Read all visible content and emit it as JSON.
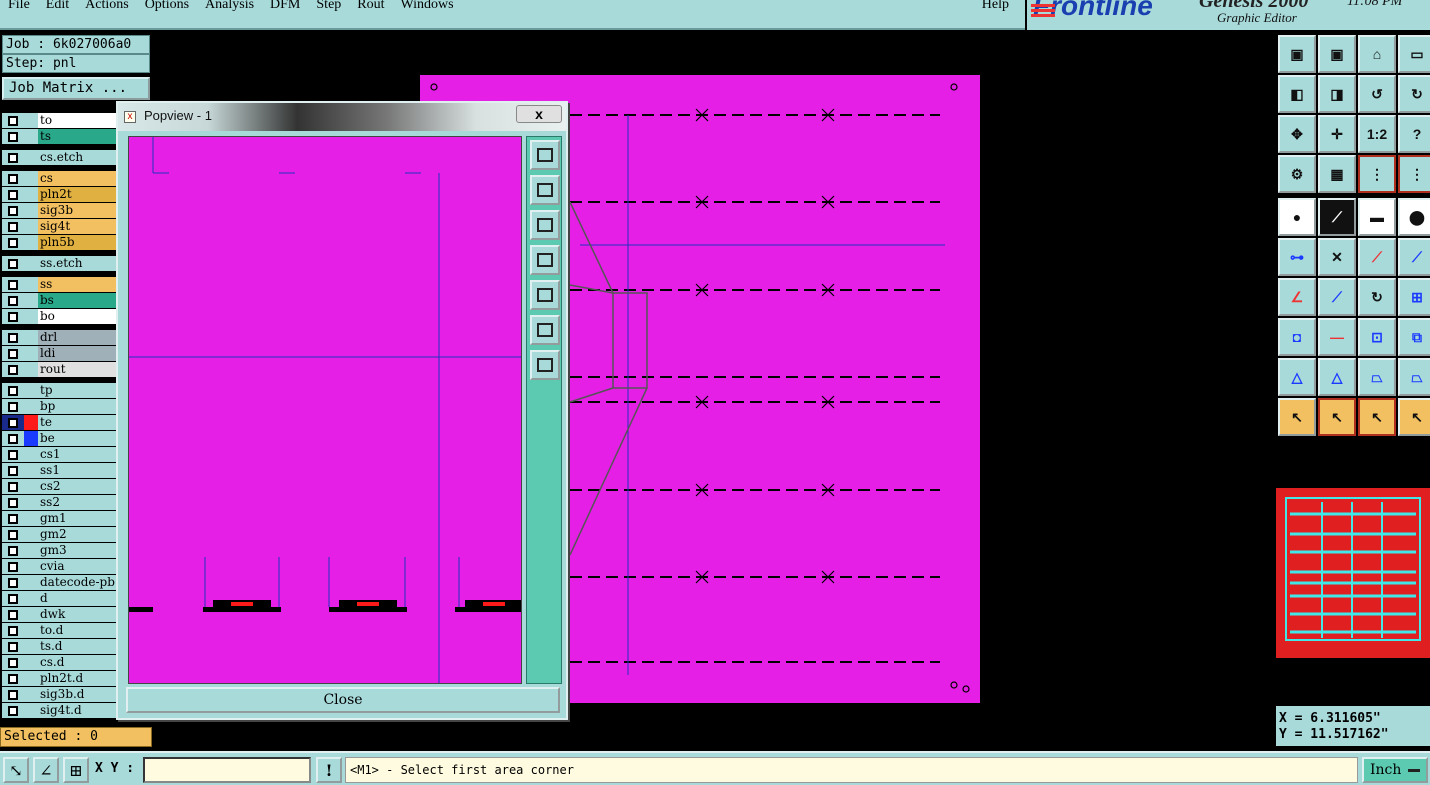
{
  "menu": {
    "items": [
      "File",
      "Edit",
      "Actions",
      "Options",
      "Analysis",
      "DFM",
      "Step",
      "Rout",
      "Windows"
    ],
    "help": "Help"
  },
  "brand": {
    "logo": "Frontline",
    "product": "Genesis 2000",
    "subtitle": "Graphic Editor",
    "clock": "11:08 PM"
  },
  "job": {
    "job_label": "Job : 6k027006a0",
    "step_label": "Step: pnl",
    "matrix_button": "Job Matrix ..."
  },
  "layers": [
    {
      "name": "to",
      "color": "#ffffff"
    },
    {
      "name": "ts",
      "color": "#2aa88a"
    },
    {
      "name": "cs.etch",
      "color": "#a8dada"
    },
    {
      "name": "cs",
      "color": "#f2c060"
    },
    {
      "name": "pln2t",
      "color": "#e0b040"
    },
    {
      "name": "sig3b",
      "color": "#f2c060"
    },
    {
      "name": "sig4t",
      "color": "#f2c060"
    },
    {
      "name": "pln5b",
      "color": "#e0b040"
    },
    {
      "name": "ss.etch",
      "color": "#a8dada"
    },
    {
      "name": "ss",
      "color": "#f2c060"
    },
    {
      "name": "bs",
      "color": "#2aa88a"
    },
    {
      "name": "bo",
      "color": "#ffffff"
    },
    {
      "name": "drl",
      "color": "#a0b0b8"
    },
    {
      "name": "ldi",
      "color": "#a0b0b8"
    },
    {
      "name": "rout",
      "color": "#e0e0e0"
    },
    {
      "name": "tp",
      "color": "#a8dada"
    },
    {
      "name": "bp",
      "color": "#a8dada"
    },
    {
      "name": "te",
      "color": "#a8dada",
      "swatch": "#ff1a1a",
      "active": true
    },
    {
      "name": "be",
      "color": "#a8dada",
      "swatch": "#1a3aff"
    },
    {
      "name": "cs1",
      "color": "#a8dada"
    },
    {
      "name": "ss1",
      "color": "#a8dada"
    },
    {
      "name": "cs2",
      "color": "#a8dada"
    },
    {
      "name": "ss2",
      "color": "#a8dada"
    },
    {
      "name": "gm1",
      "color": "#a8dada"
    },
    {
      "name": "gm2",
      "color": "#a8dada"
    },
    {
      "name": "gm3",
      "color": "#a8dada"
    },
    {
      "name": "cvia",
      "color": "#a8dada"
    },
    {
      "name": "datecode-pb",
      "color": "#a8dada"
    },
    {
      "name": "d",
      "color": "#a8dada"
    },
    {
      "name": "dwk",
      "color": "#a8dada"
    },
    {
      "name": "to.d",
      "color": "#a8dada"
    },
    {
      "name": "ts.d",
      "color": "#a8dada"
    },
    {
      "name": "cs.d",
      "color": "#a8dada"
    },
    {
      "name": "pln2t.d",
      "color": "#a8dada"
    },
    {
      "name": "sig3b.d",
      "color": "#a8dada"
    },
    {
      "name": "sig4t.d",
      "color": "#a8dada"
    }
  ],
  "selected": "Selected : 0",
  "popview": {
    "title": "Popview - 1",
    "close_x": "x",
    "close_button": "Close"
  },
  "toolbar_labels": {
    "ratio": "1:2",
    "help": "?"
  },
  "coords": {
    "x": "X = 6.311605\"",
    "y": "Y = 11.517162\""
  },
  "status": {
    "xy_label": "X Y :",
    "xy_value": "",
    "message": "<M1> - Select first area corner",
    "units": "Inch",
    "alert": "!"
  },
  "colors": {
    "panel": "#a8dada",
    "board": "#e61fe6",
    "accent": "#5ccab0"
  }
}
